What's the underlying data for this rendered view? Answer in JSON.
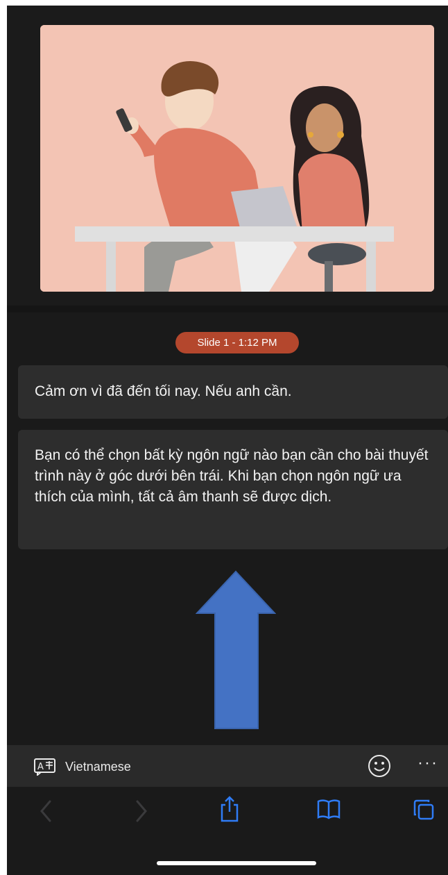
{
  "slide": {
    "badge_label": "Slide 1 - 1:12 PM"
  },
  "captions": [
    "Cảm ơn vì đã đến tối nay. Nếu anh cần.",
    "Bạn có thể chọn bất kỳ ngôn ngữ nào bạn cần cho bài thuyết trình này ở góc dưới bên trái. Khi bạn chọn ngôn ngữ ưa thích của mình, tất cả âm thanh sẽ được dịch."
  ],
  "language_bar": {
    "language_label": "Vietnamese",
    "language_icon": "translate-icon",
    "reaction_icon": "smiley-icon",
    "more_label": "···"
  },
  "browser_toolbar": {
    "icons": [
      "back-icon",
      "forward-icon",
      "share-icon",
      "bookmarks-icon",
      "tabs-icon"
    ]
  },
  "colors": {
    "badge": "#b4472d",
    "annotation_arrow": "#4472c4",
    "slide_background": "#f3c4b4",
    "toolbar_accent": "#2f7cf6"
  }
}
